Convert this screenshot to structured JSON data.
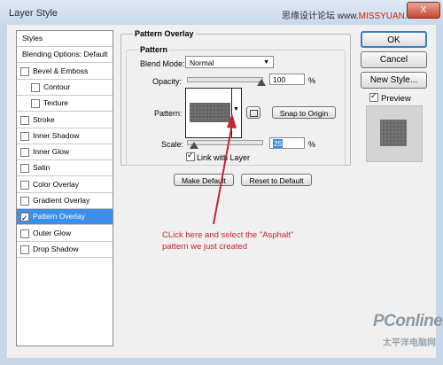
{
  "window": {
    "title": "Layer Style",
    "close": "X"
  },
  "watermark": {
    "text_a": "思缘设计论坛 www.",
    "text_b": "MISSYUAN",
    "text_c": ".com"
  },
  "styles_list": [
    {
      "label": "Styles",
      "checkbox": false,
      "checked": false,
      "indent": 0,
      "selected": false
    },
    {
      "label": "Blending Options: Default",
      "checkbox": false,
      "checked": false,
      "indent": 0,
      "selected": false
    },
    {
      "label": "Bevel & Emboss",
      "checkbox": true,
      "checked": false,
      "indent": 0,
      "selected": false
    },
    {
      "label": "Contour",
      "checkbox": true,
      "checked": false,
      "indent": 1,
      "selected": false
    },
    {
      "label": "Texture",
      "checkbox": true,
      "checked": false,
      "indent": 1,
      "selected": false
    },
    {
      "label": "Stroke",
      "checkbox": true,
      "checked": false,
      "indent": 0,
      "selected": false
    },
    {
      "label": "Inner Shadow",
      "checkbox": true,
      "checked": false,
      "indent": 0,
      "selected": false
    },
    {
      "label": "Inner Glow",
      "checkbox": true,
      "checked": false,
      "indent": 0,
      "selected": false
    },
    {
      "label": "Satin",
      "checkbox": true,
      "checked": false,
      "indent": 0,
      "selected": false
    },
    {
      "label": "Color Overlay",
      "checkbox": true,
      "checked": false,
      "indent": 0,
      "selected": false
    },
    {
      "label": "Gradient Overlay",
      "checkbox": true,
      "checked": false,
      "indent": 0,
      "selected": false
    },
    {
      "label": "Pattern Overlay",
      "checkbox": true,
      "checked": true,
      "indent": 0,
      "selected": true
    },
    {
      "label": "Outer Glow",
      "checkbox": true,
      "checked": false,
      "indent": 0,
      "selected": false
    },
    {
      "label": "Drop Shadow",
      "checkbox": true,
      "checked": false,
      "indent": 0,
      "selected": false
    }
  ],
  "panel": {
    "group_title": "Pattern Overlay",
    "subgroup_title": "Pattern",
    "blend_mode_label": "Blend Mode:",
    "blend_mode_value": "Normal",
    "opacity_label": "Opacity:",
    "opacity_value": "100",
    "opacity_unit": "%",
    "opacity_level": 1.0,
    "pattern_label": "Pattern:",
    "pattern_name": "Asphalt",
    "snap_button": "Snap to Origin",
    "scale_label": "Scale:",
    "scale_value": "25",
    "scale_unit": "%",
    "scale_level": 0.1,
    "link_label": "Link with Layer",
    "link_checked": true,
    "make_default": "Make Default",
    "reset_default": "Reset to Default"
  },
  "buttons": {
    "ok": "OK",
    "cancel": "Cancel",
    "new_style": "New Style..."
  },
  "preview": {
    "label": "Preview",
    "checked": true
  },
  "annotation": {
    "line1": "CLick here and select the \"Asphalt\"",
    "line2": "pattern we just created",
    "color": "#c1272d"
  },
  "logo": {
    "text": "PConline",
    "subtext": "太平洋电脑网"
  }
}
